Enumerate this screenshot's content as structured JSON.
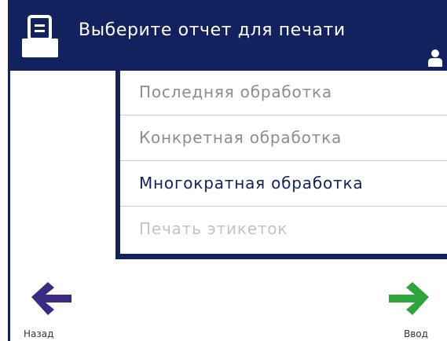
{
  "header": {
    "title": "Выберите отчет для печати",
    "icon": "printer-icon",
    "user_icon": "user-icon"
  },
  "list": {
    "items": [
      {
        "label": "Последняя обработка",
        "state": "normal"
      },
      {
        "label": "Конкретная обработка",
        "state": "normal"
      },
      {
        "label": "Многократная обработка",
        "state": "active"
      },
      {
        "label": "Печать этикеток",
        "state": "disabled"
      }
    ]
  },
  "footer": {
    "back_label": "Назад",
    "enter_label": "Ввод"
  },
  "colors": {
    "header_bg": "#13215e",
    "back_arrow": "#3b2a82",
    "enter_arrow": "#2ca53b",
    "text_active": "#13215e",
    "text_normal": "#8d8d8d",
    "text_disabled": "#c3c3c3"
  }
}
